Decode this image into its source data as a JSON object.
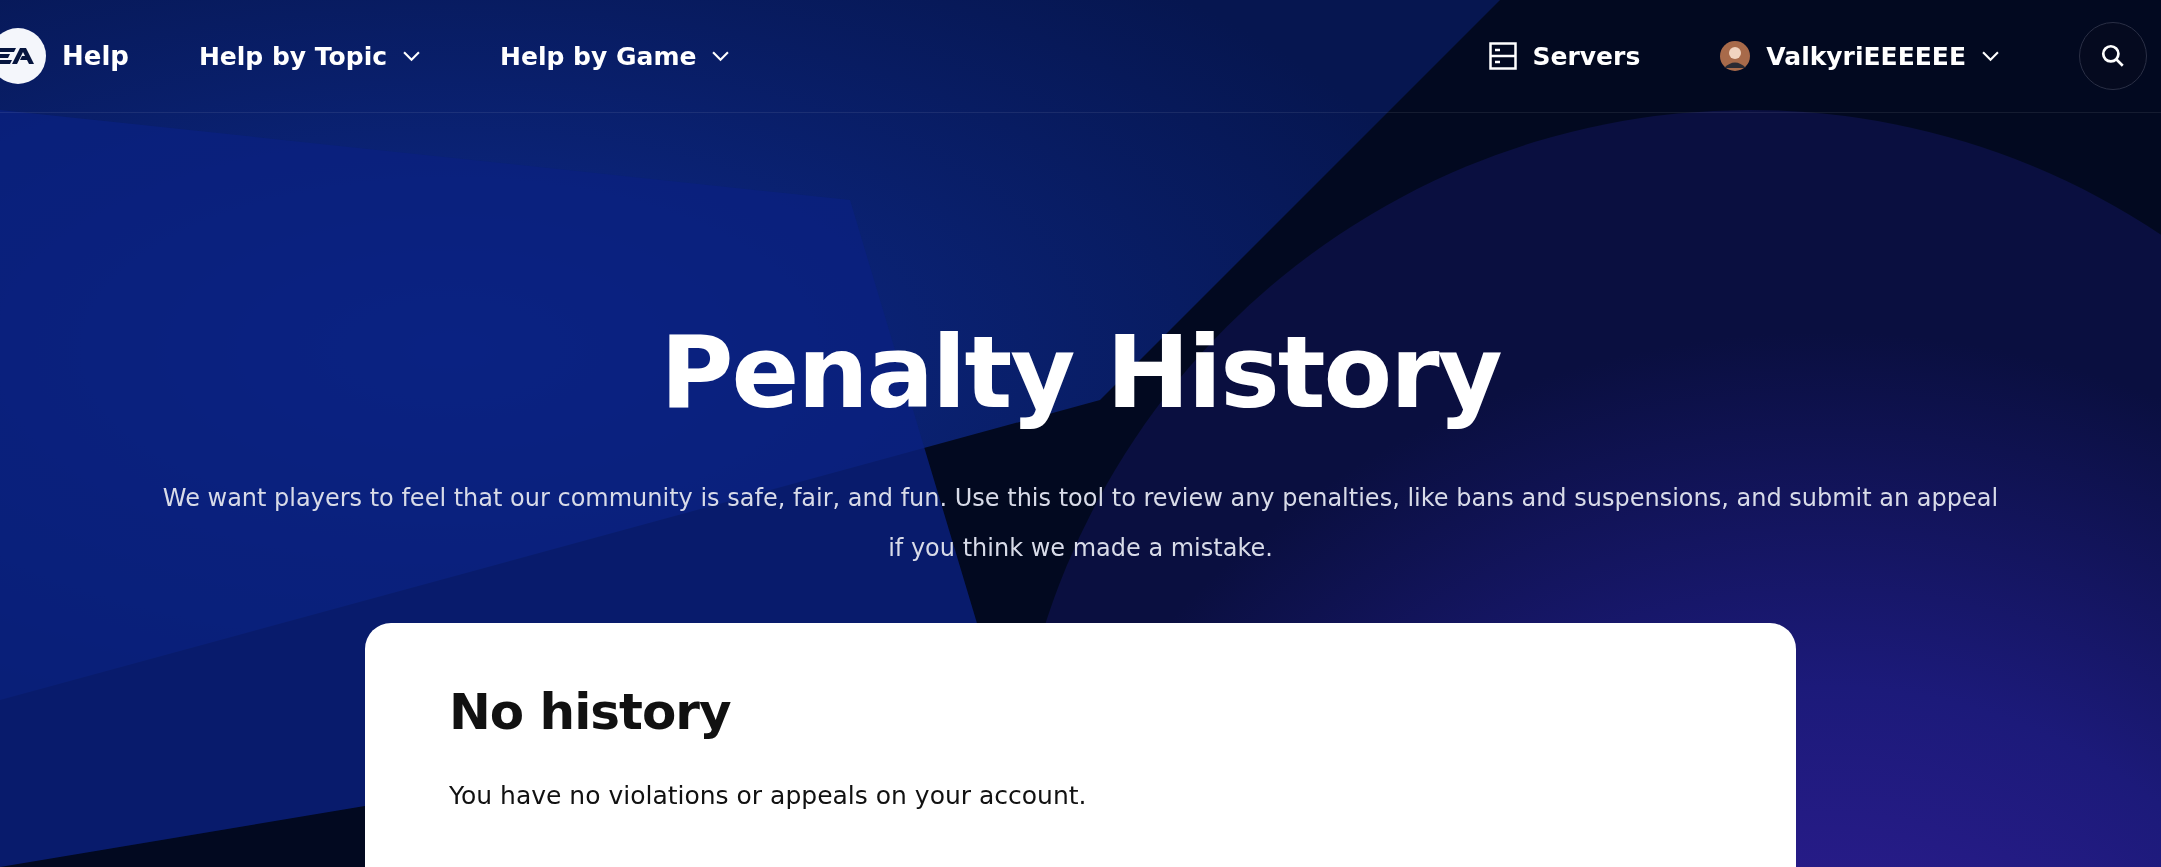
{
  "header": {
    "logo_label": "Help",
    "nav": [
      {
        "label": "Help by Topic"
      },
      {
        "label": "Help by Game"
      }
    ],
    "servers": {
      "label": "Servers"
    },
    "user": {
      "name": "ValkyriEEEEEE"
    }
  },
  "hero": {
    "title": "Penalty History",
    "description": "We want players to feel that our community is safe, fair, and fun. Use this tool to review any penalties, like bans and suspensions, and submit an appeal if you think we made a mistake."
  },
  "card": {
    "heading": "No history",
    "message": "You have no violations or appeals on your account."
  }
}
